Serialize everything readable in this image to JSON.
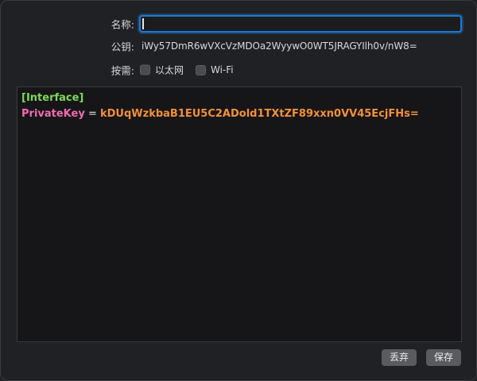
{
  "form": {
    "name_label": "名称:",
    "name_value": "",
    "pubkey_label": "公钥:",
    "pubkey_value": "iWy57DmR6wVXcVzMDOa2WyywO0WT5JRAGYIlh0v/nW8=",
    "on_demand_label": "按需:",
    "on_demand_options": [
      {
        "label": "以太网",
        "checked": false
      },
      {
        "label": "Wi-Fi",
        "checked": false
      }
    ]
  },
  "editor": {
    "section_header": "[Interface]",
    "key_name": "PrivateKey",
    "equals": " = ",
    "key_value": "kDUqWzkbaB1EU5C2ADold1TXtZF89xxn0VV45EcjFHs="
  },
  "buttons": {
    "discard_label": "丢弃",
    "save_label": "保存"
  },
  "colors": {
    "focus_ring": "#1f78d1",
    "section_header": "#7ed957",
    "key_name": "#f06bb0",
    "key_value": "#f3903a"
  }
}
